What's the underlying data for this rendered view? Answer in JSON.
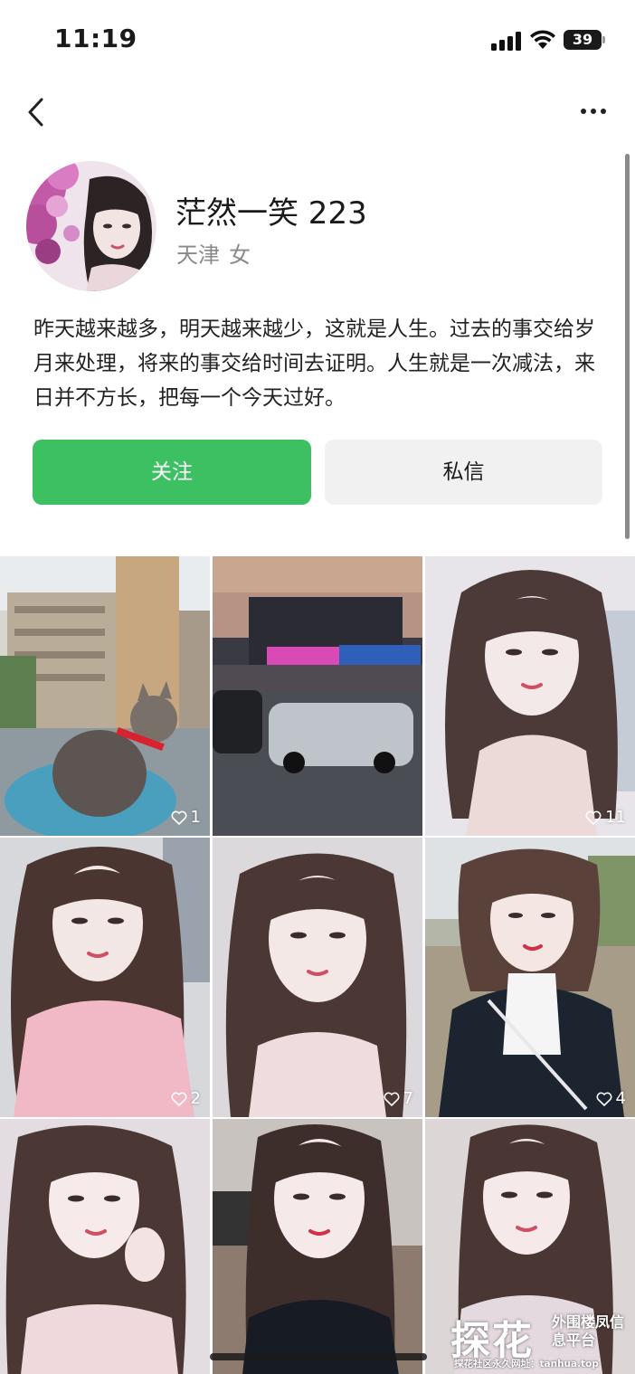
{
  "status_bar": {
    "time": "11:19",
    "battery_level": "39"
  },
  "nav": {
    "back_icon": "chevron-left-icon",
    "more_icon": "more-horizontal-icon"
  },
  "profile": {
    "nickname": "茫然一笑 223",
    "location": "天津",
    "gender": "女",
    "bio": "昨天越来越多，明天越来越少，这就是人生。过去的事交给岁月来处理，将来的事交给时间去证明。人生就是一次减法，来日并不方长，把每一个今天过好。"
  },
  "actions": {
    "follow_label": "关注",
    "message_label": "私信"
  },
  "colors": {
    "accent_green": "#3dc062",
    "secondary_button": "#f1f1f1",
    "muted_text": "#8a8a8a"
  },
  "posts": [
    {
      "subject": "cat-window",
      "likes": "1"
    },
    {
      "subject": "street-restaurant",
      "likes": ""
    },
    {
      "subject": "selfie",
      "likes": "11"
    },
    {
      "subject": "selfie",
      "likes": "2"
    },
    {
      "subject": "selfie",
      "likes": "7"
    },
    {
      "subject": "selfie",
      "likes": "4"
    },
    {
      "subject": "selfie",
      "likes": ""
    },
    {
      "subject": "selfie",
      "likes": ""
    },
    {
      "subject": "selfie",
      "likes": ""
    }
  ],
  "watermark": {
    "logo_text": "探花",
    "side_text": "外围楼凤信息平台",
    "bottom_text": "探花社区永久网址：tanhua.top"
  }
}
